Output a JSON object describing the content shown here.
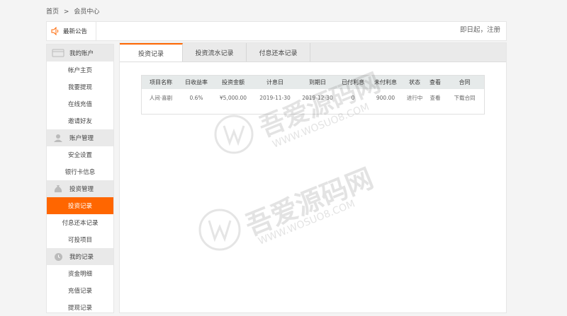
{
  "breadcrumb": {
    "home": "首页",
    "sep": ">",
    "current": "会员中心"
  },
  "notice": {
    "title": "最新公告",
    "text": "即日起，注册"
  },
  "sidebar": {
    "groups": [
      {
        "label": "我的账户",
        "items": [
          "帐户主页",
          "我要提现",
          "在线充值",
          "邀请好友"
        ]
      },
      {
        "label": "账户管理",
        "items": [
          "安全设置",
          "银行卡信息"
        ]
      },
      {
        "label": "投资管理",
        "items": [
          "投资记录",
          "付息还本记录",
          "可投项目"
        ]
      },
      {
        "label": "我的记录",
        "items": [
          "资金明细",
          "充值记录",
          "提现记录"
        ]
      }
    ],
    "active_item": "投资记录"
  },
  "tabs": [
    "投资记录",
    "投资流水记录",
    "付息还本记录"
  ],
  "active_tab": "投资记录",
  "table": {
    "headers": [
      "项目名称",
      "日收益率",
      "投资金额",
      "计息日",
      "到期日",
      "已付利息",
      "未付利息",
      "状态",
      "查看",
      "合同"
    ],
    "rows": [
      [
        "人间·喜剧",
        "0.6%",
        "¥5,000.00",
        "2019-11-30",
        "2019-12-30",
        "0",
        "900.00",
        "进行中",
        "查看",
        "下载合同"
      ]
    ]
  },
  "watermark": {
    "text": "吾爱源码网",
    "url": "WWW.WOSUO8.COM"
  },
  "colors": {
    "accent": "#ff6600",
    "tab_bg": "#eaeaea",
    "header_bg": "#e6eaea",
    "group_bg": "#e9e9e9"
  }
}
